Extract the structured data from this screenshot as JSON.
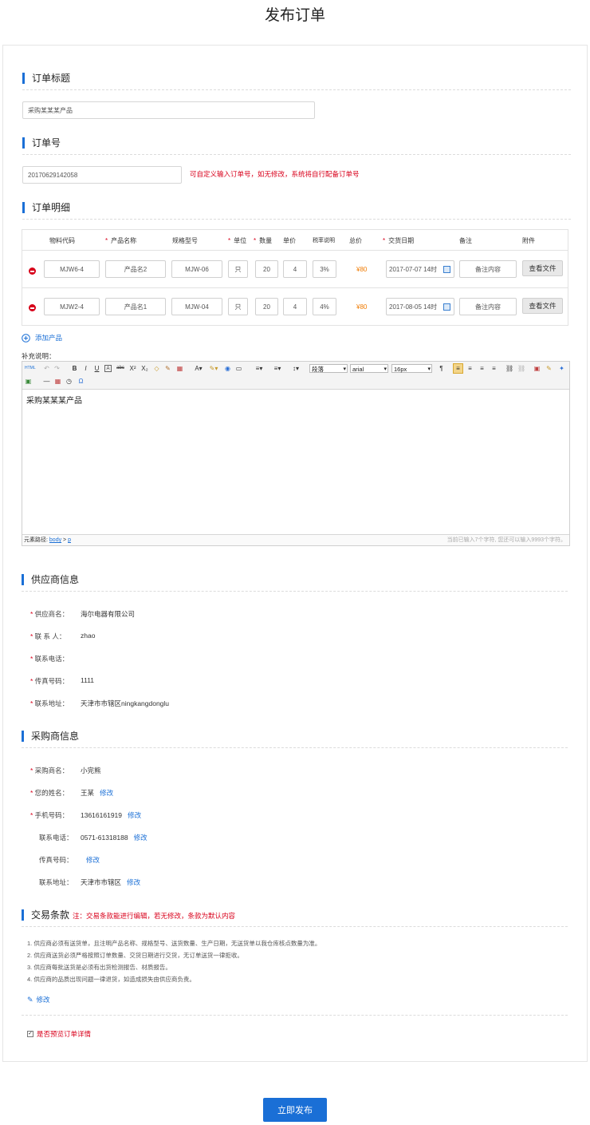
{
  "page_title": "发布订单",
  "order_title": {
    "section": "订单标题",
    "value": "采购某某某产品"
  },
  "order_no": {
    "section": "订单号",
    "value": "20170629142058",
    "hint": "可自定义输入订单号，如无修改，系统将自行配备订单号"
  },
  "order_detail": {
    "section": "订单明细",
    "headers": {
      "code": "物料代码",
      "name": "产品名称",
      "spec": "规格型号",
      "unit": "单位",
      "qty": "数量",
      "price": "单价",
      "tax": "税率说明",
      "total": "总价",
      "date": "交货日期",
      "note": "备注",
      "attach": "附件"
    },
    "required_mark": "*",
    "rows": [
      {
        "code": "MJW6-4",
        "name": "产品名2",
        "spec": "MJW-06",
        "unit": "只",
        "qty": "20",
        "price": "4",
        "tax": "3%",
        "total": "¥80",
        "date": "2017-07-07 14时",
        "note": "备注内容",
        "attach_btn": "查看文件"
      },
      {
        "code": "MJW2-4",
        "name": "产品名1",
        "spec": "MJW-04",
        "unit": "只",
        "qty": "20",
        "price": "4",
        "tax": "4%",
        "total": "¥80",
        "date": "2017-08-05 14时",
        "note": "备注内容",
        "attach_btn": "查看文件"
      }
    ],
    "add_product": "添加产品"
  },
  "supplement": {
    "label": "补充说明：",
    "toolbar": {
      "html_btn": "HTML",
      "paragraph": "段落",
      "font": "arial",
      "size": "16px"
    },
    "content": "采购某某某产品",
    "path_label": "元素路径:",
    "path_body": "body",
    "path_sep": ">",
    "path_p": "p",
    "counter": "当前已输入7个字符, 您还可以输入9993个字符。"
  },
  "supplier": {
    "section": "供应商信息",
    "fields": [
      {
        "label": "供应商名：",
        "value": "海尔电器有限公司",
        "required": true
      },
      {
        "label": "联 系 人：",
        "value": "zhao",
        "required": true
      },
      {
        "label": "联系电话：",
        "value": "",
        "required": true
      },
      {
        "label": "传真号码：",
        "value": "1111",
        "required": true
      },
      {
        "label": "联系地址：",
        "value": "天津市市辖区ningkangdonglu",
        "required": true
      }
    ]
  },
  "buyer": {
    "section": "采购商信息",
    "fields": [
      {
        "label": "采购商名：",
        "value": "小完熊",
        "edit": "",
        "required": true
      },
      {
        "label": "您的姓名：",
        "value": "王某",
        "edit": "修改",
        "required": true
      },
      {
        "label": "手机号码：",
        "value": "13616161919",
        "edit": "修改",
        "required": true
      },
      {
        "label": "联系电话：",
        "value": "0571-61318188",
        "edit": "修改",
        "required": false
      },
      {
        "label": "传真号码：",
        "value": "",
        "edit": "修改",
        "required": false
      },
      {
        "label": "联系地址：",
        "value": "天津市市辖区",
        "edit": "修改",
        "required": false
      }
    ]
  },
  "terms": {
    "section": "交易条款",
    "note": "注：交易条款能进行编辑，若无修改，条款为默认内容",
    "items": [
      "1. 供应商必须有送货单，且注明产品名称、规格型号、送货数量、生产日期，无送货单以我仓库核点数量为准。",
      "2. 供应商送货必须严格按照订单数量、交货日期进行交货，无订单送货一律拒收。",
      "3. 供应商每批送货是必须有出货检测报告、材质报告。",
      "4. 供应商的品质出现问题一律退货，如造成损失由供应商负责。"
    ],
    "edit": "修改"
  },
  "preview": {
    "label": "是否预览订单详情",
    "checked": true
  },
  "submit": "立即发布",
  "colors": {
    "accent": "#1a6fd6",
    "required": "#d9001b",
    "price": "#f07a00"
  }
}
